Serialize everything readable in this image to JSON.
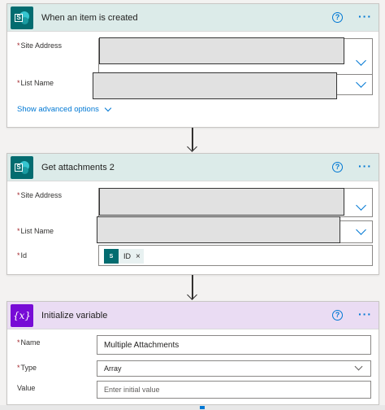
{
  "trigger": {
    "title": "When an item is created",
    "fields": {
      "site_address_label": "Site Address",
      "list_name_label": "List Name"
    },
    "advanced_link": "Show advanced options"
  },
  "get_attachments": {
    "title": "Get attachments 2",
    "fields": {
      "site_address_label": "Site Address",
      "list_name_label": "List Name",
      "id_label": "Id"
    },
    "token": {
      "label": "ID",
      "remove": "×"
    }
  },
  "init_variable": {
    "title": "Initialize variable",
    "name_label": "Name",
    "name_value": "Multiple Attachments",
    "type_label": "Type",
    "type_value": "Array",
    "value_label": "Value",
    "value_placeholder": "Enter initial value"
  },
  "common": {
    "required_mark": "*",
    "help_glyph": "?",
    "more_glyph": "···"
  },
  "icons": {
    "connector": "sharepoint-icon",
    "variable": "variable-icon",
    "help": "help-icon",
    "more": "more-options-icon",
    "dropdown": "chevron-down-icon",
    "arrow": "arrow-down-icon"
  },
  "colors": {
    "sharepoint_header": "#dcebe9",
    "sharepoint_brand": "#036c70",
    "variable_header": "#eadcf3",
    "variable_brand": "#770bd6",
    "accent": "#0078d4",
    "required": "#a4262c"
  }
}
